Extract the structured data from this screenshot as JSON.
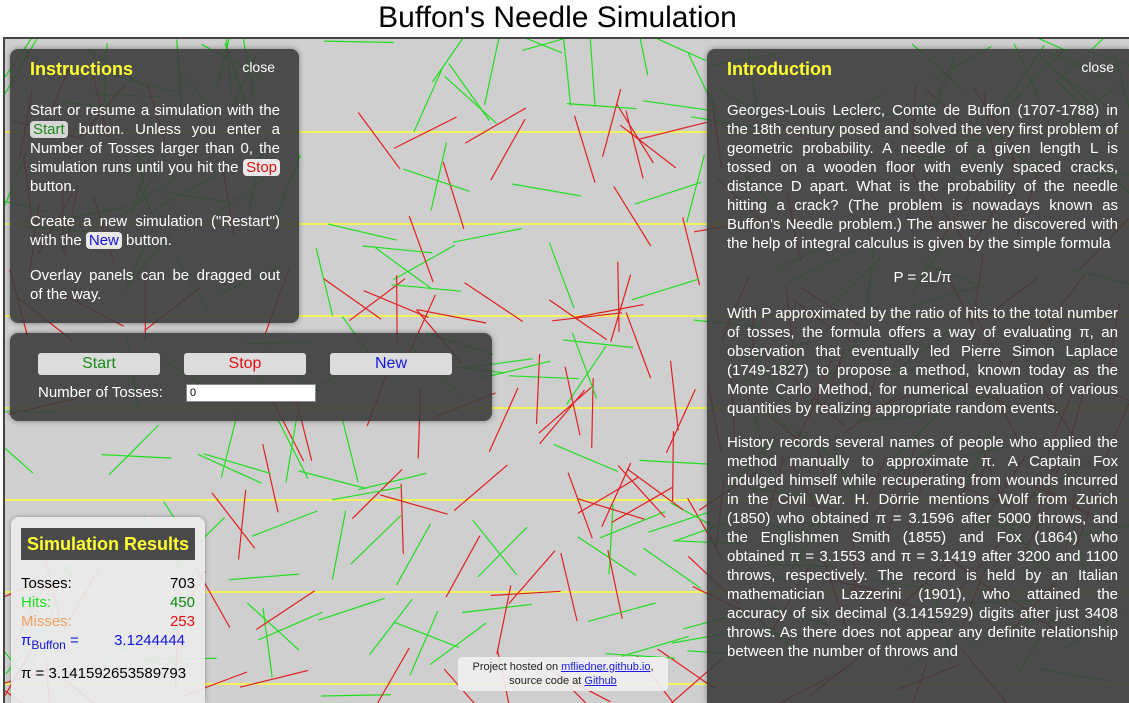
{
  "page_title": "Buffon's Needle Simulation",
  "instructions": {
    "title": "Instructions",
    "close": "close",
    "p1_a": "Start or resume a simulation with the ",
    "p1_start": "Start",
    "p1_b": " button. Unless you enter a Number of Tosses larger than 0, the simulation runs until you hit the ",
    "p1_stop": "Stop",
    "p1_c": " button.",
    "p2_a": "Create a new simulation (\"Restart\") with the ",
    "p2_new": "New",
    "p2_b": " button.",
    "p3": "Overlay panels can be dragged out of the way."
  },
  "controls": {
    "start": "Start",
    "stop": "Stop",
    "new": "New",
    "tosses_label": "Number of Tosses:",
    "tosses_value": "0"
  },
  "results": {
    "title": "Simulation Results",
    "tosses_label": "Tosses:",
    "tosses": "703",
    "hits_label": "Hits:",
    "hits": "450",
    "misses_label": "Misses:",
    "misses": "253",
    "pi_buffon_label": "π",
    "pi_buffon_sub": "Buffon",
    "pi_buffon_eq": " =",
    "pi_buffon": "3.1244444",
    "pi_true": "π = 3.141592653589793"
  },
  "introduction": {
    "title": "Introduction",
    "close": "close",
    "p1": "Georges-Louis Leclerc, Comte de Buffon (1707-1788) in the 18th century posed and solved the very first problem of geometric probability. A needle of a given length L is tossed on a wooden floor with evenly spaced cracks, distance D apart. What is the probability of the needle hitting a crack? (The problem is nowadays known as Buffon's Needle problem.) The answer he discovered with the help of integral calculus is given by the simple formula",
    "formula": "P = 2L/π",
    "p2": "With P approximated by the ratio of hits to the total number of tosses, the formula offers a way of evaluating π, an observation that eventually led Pierre Simon Laplace (1749-1827) to propose a method, known today as the Monte Carlo Method, for numerical evaluation of various quantities by realizing appropriate random events.",
    "p3": "History records several names of people who applied the method manually to approximate π. A Captain Fox indulged himself while recuperating from wounds incurred in the Civil War. H. Dörrie mentions Wolf from Zurich (1850) who obtained π = 3.1596 after 5000 throws, and the Englishmen Smith (1855) and Fox (1864) who obtained π = 3.1553 and π = 3.1419 after 3200 and 1100 throws, respectively. The record is held by an Italian mathematician Lazzerini (1901), who attained the accuracy of six decimal (3.1415929) digits after just 3408 throws. As there does not appear any definite relationship between the number of throws and"
  },
  "footer": {
    "line1_a": "Project hosted on ",
    "line1_link": "mfliedner.github.io",
    "line1_b": ",",
    "line2_a": "source code at ",
    "line2_link": "Github"
  },
  "colors": {
    "hit_needle": "#e02020",
    "miss_needle": "#22dd22",
    "crack_line": "#ffff33",
    "panel_title": "#ffff33"
  }
}
